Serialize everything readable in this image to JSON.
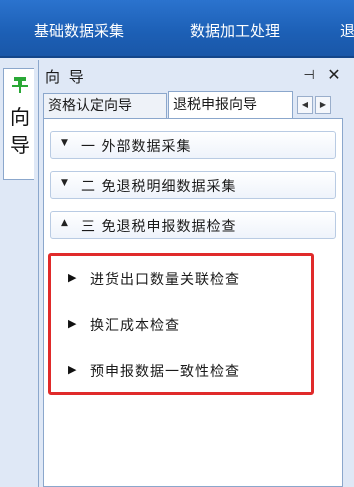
{
  "menubar": {
    "items": [
      "基础数据采集",
      "数据加工处理",
      "退"
    ]
  },
  "vertical_tab": {
    "label": "向导",
    "icon": "pin-icon",
    "pin_color": "#2aa836"
  },
  "panel": {
    "title": "向 导",
    "pin_glyph": "⊣",
    "close_glyph": "✕",
    "tabs": [
      {
        "label": "资格认定向导",
        "active": false
      },
      {
        "label": "退税申报向导",
        "active": true
      }
    ],
    "scroll_left": "◀",
    "scroll_right": "▶"
  },
  "sections": [
    {
      "caret": "▼",
      "label": "一  外部数据采集",
      "expanded": false
    },
    {
      "caret": "▼",
      "label": "二  免退税明细数据采集",
      "expanded": false
    },
    {
      "caret": "▲",
      "label": "三  免退税申报数据检查",
      "expanded": true
    }
  ],
  "items": [
    {
      "label": "进货出口数量关联检查"
    },
    {
      "label": "换汇成本检查"
    },
    {
      "label": "预申报数据一致性检查"
    }
  ],
  "colors": {
    "menubar": "#1c5fb5",
    "highlight_border": "#e02a2a",
    "panel_bg": "#dfe8f6"
  }
}
